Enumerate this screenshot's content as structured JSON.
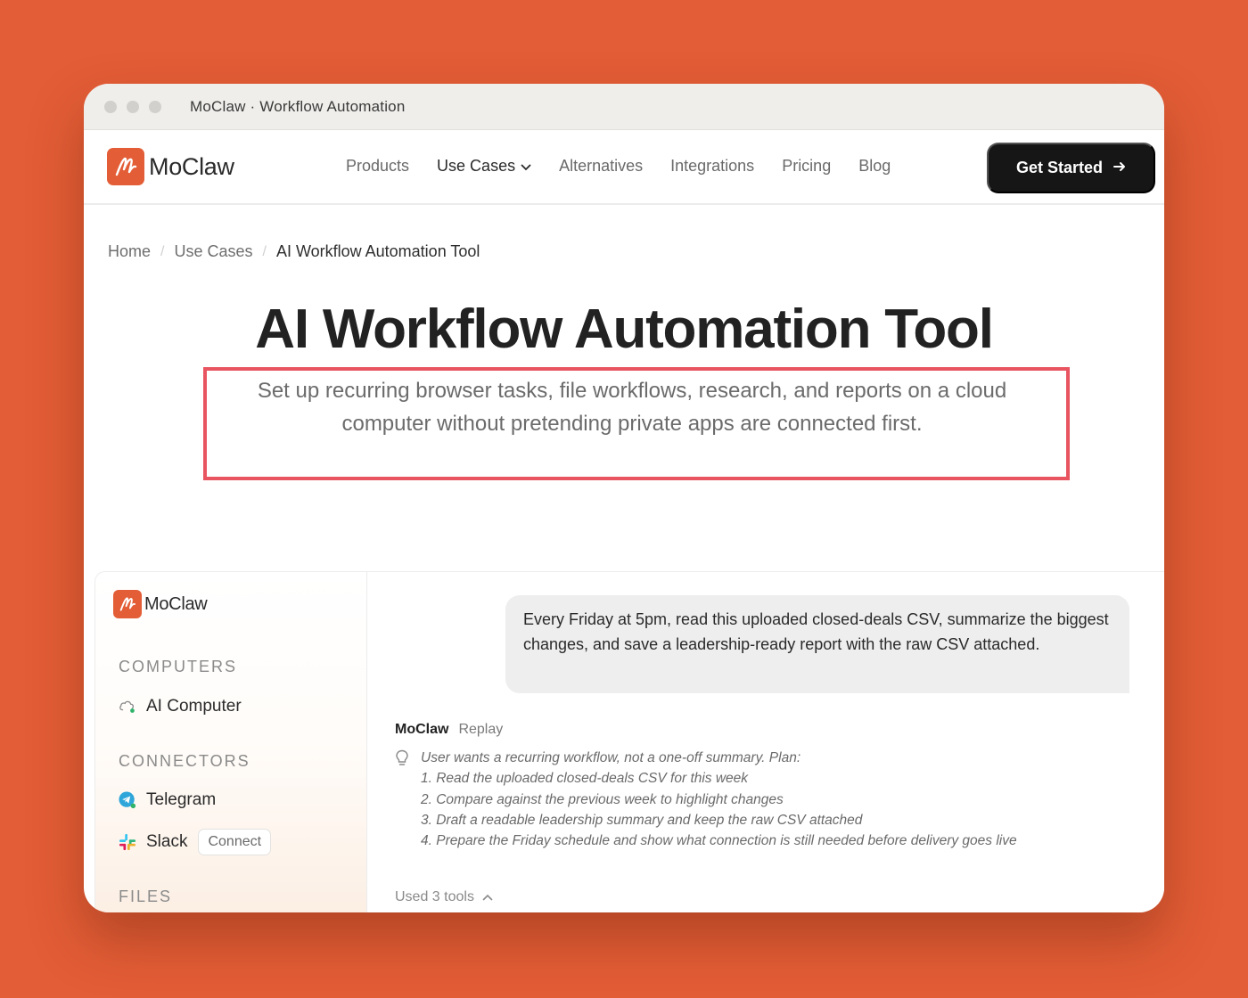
{
  "window": {
    "title": "MoClaw · Workflow Automation"
  },
  "nav": {
    "brand": "MoClaw",
    "links": [
      {
        "label": "Products"
      },
      {
        "label": "Use Cases",
        "active": true,
        "has_dropdown": true
      },
      {
        "label": "Alternatives"
      },
      {
        "label": "Integrations"
      },
      {
        "label": "Pricing"
      },
      {
        "label": "Blog"
      }
    ],
    "cta": {
      "label": "Get Started",
      "icon": "arrow-right-icon"
    }
  },
  "breadcrumb": {
    "items": [
      "Home",
      "Use Cases",
      "AI Workflow Automation Tool"
    ],
    "separator": "/"
  },
  "hero": {
    "title": "AI Workflow Automation Tool",
    "subtitle_line1": "Set up recurring browser tasks, file workflows, research, and reports on a cloud",
    "subtitle_line2": "computer without pretending private apps are connected first."
  },
  "app_preview": {
    "sidebar": {
      "brand": "MoClaw",
      "computers_heading": "COMPUTERS",
      "computer_item": "AI Computer",
      "connectors_heading": "CONNECTORS",
      "telegram": "Telegram",
      "slack": "Slack",
      "slack_connect": "Connect",
      "files_heading": "FILES"
    },
    "chat": {
      "user_message": "Every Friday at 5pm, read this uploaded closed-deals CSV, summarize the biggest changes, and save a leadership-ready report with the raw CSV attached.",
      "author": "MoClaw",
      "replay": "Replay",
      "thought_lines": [
        "User wants a recurring workflow, not a one-off summary. Plan:",
        "1. Read the uploaded closed-deals CSV for this week",
        "2. Compare against the previous week to highlight changes",
        "3. Draft a readable leadership summary and keep the raw CSV attached",
        "4. Prepare the Friday schedule and show what connection is still needed before delivery goes live"
      ],
      "used_tools": "Used 3 tools"
    }
  },
  "colors": {
    "background": "#e35d36",
    "brand": "#e35d36",
    "cta": "#161616",
    "highlight": "#e85460"
  }
}
